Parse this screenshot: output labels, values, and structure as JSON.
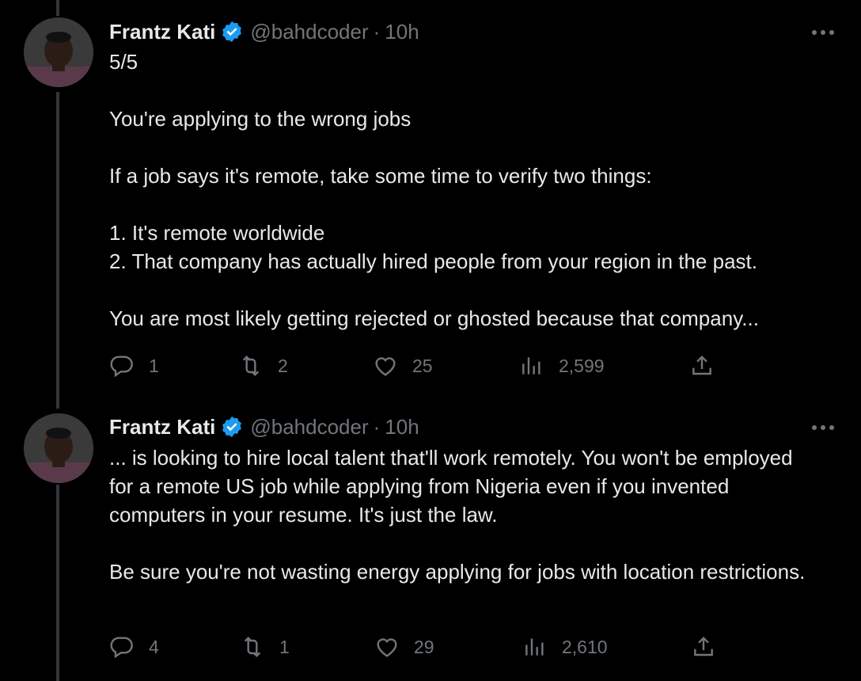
{
  "tweets": [
    {
      "author_name": "Frantz Kati",
      "handle": "@bahdcoder",
      "separator": "·",
      "time": "10h",
      "text": "5/5\n\nYou're applying to the wrong jobs\n\nIf a job says it's remote, take some time to verify two things:\n\n1. It's remote worldwide\n2. That company has actually hired people from your region in the past.\n\nYou are most likely getting rejected or ghosted because that company...",
      "replies": "1",
      "reposts": "2",
      "likes": "25",
      "views": "2,599"
    },
    {
      "author_name": "Frantz Kati",
      "handle": "@bahdcoder",
      "separator": "·",
      "time": "10h",
      "text": "... is looking to hire local talent that'll work remotely. You won't be employed for a remote US job while applying from Nigeria even if you invented computers in your resume. It's just the law.\n\n  Be sure you're not wasting energy applying for jobs with location restrictions.",
      "replies": "4",
      "reposts": "1",
      "likes": "29",
      "views": "2,610"
    }
  ],
  "icons": {
    "verified": "verified-badge-icon",
    "more": "more-icon",
    "reply": "reply-icon",
    "repost": "repost-icon",
    "like": "like-icon",
    "views": "views-icon",
    "share": "share-icon"
  },
  "colors": {
    "background": "#000000",
    "text": "#e7e9ea",
    "secondary": "#71767b",
    "verified": "#1d9bf0",
    "thread_line": "#333639"
  }
}
